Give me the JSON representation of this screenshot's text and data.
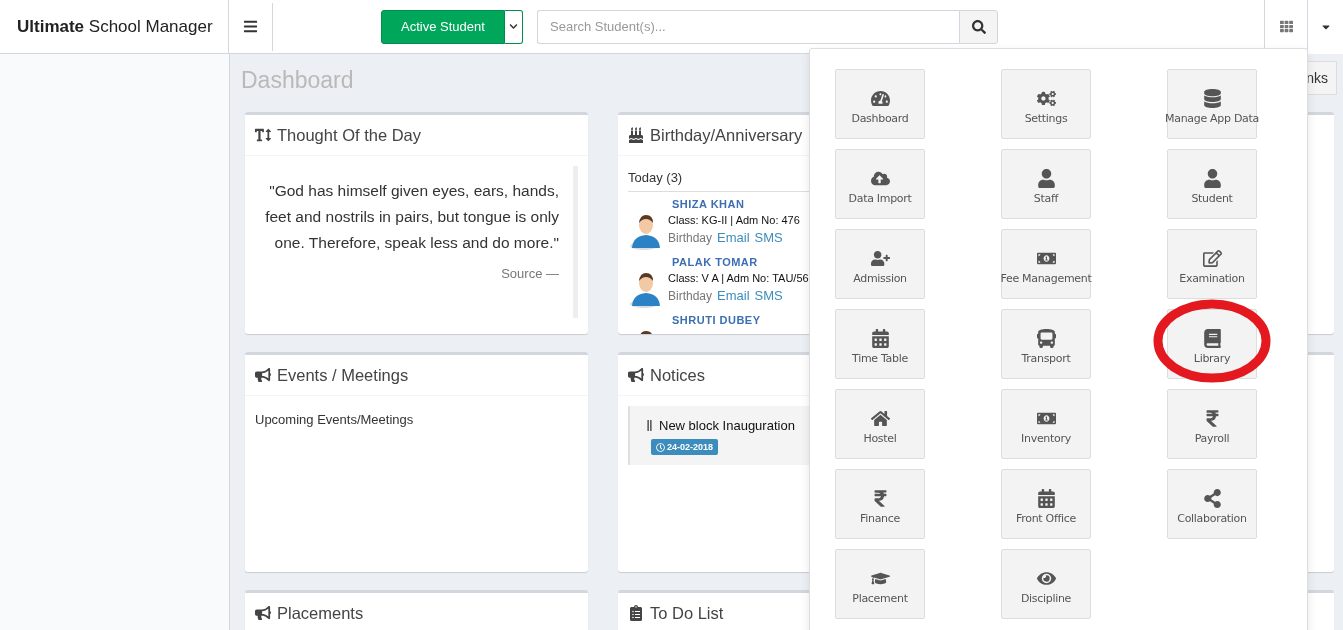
{
  "header": {
    "logo": "**Ultimate** School Manager",
    "student_filter": {
      "label": "Active Student"
    },
    "search": {
      "placeholder": "Search Student(s)..."
    }
  },
  "page_title": "Dashboard",
  "links_button": {
    "label": "nks"
  },
  "cards": [
    {
      "kind": "quote",
      "title": "Thought Of the Day",
      "quote": "\"God has himself given eyes, ears, hands, feet and nostrils in pairs, but tongue is only one. Therefore, speak less and do more.\"",
      "source": "Source —"
    },
    {
      "kind": "birthdays",
      "title": "Birthday/Anniversary",
      "subtitle": "Today (3)",
      "people": [
        {
          "name": "SHIZA KHAN",
          "details": "Class: KG-II | Adm No: 476",
          "occasion": "Birthday",
          "actions": [
            "Email",
            "SMS"
          ]
        },
        {
          "name": "PALAK TOMAR",
          "details": "Class: V A | Adm No: TAU/56",
          "occasion": "Birthday",
          "actions": [
            "Email",
            "SMS"
          ]
        },
        {
          "name": "SHRUTI DUBEY"
        }
      ]
    },
    {
      "kind": "covered"
    },
    {
      "kind": "events",
      "title": "Events / Meetings",
      "text": "Upcoming Events/Meetings"
    },
    {
      "kind": "notices",
      "title": "Notices",
      "notices": [
        {
          "title": "New block Inauguration",
          "date": "24-02-2018"
        }
      ]
    },
    {
      "kind": "covered"
    },
    {
      "kind": "placements",
      "title": "Placements"
    },
    {
      "kind": "todo",
      "title": "To Do List"
    },
    {
      "kind": "covered"
    }
  ],
  "app_menu": {
    "tiles": [
      {
        "label": "Dashboard",
        "highlighted": false
      },
      {
        "label": "Settings",
        "highlighted": false
      },
      {
        "label": "Manage App Data",
        "highlighted": false
      },
      {
        "label": "Data Import",
        "highlighted": false
      },
      {
        "label": "Staff",
        "highlighted": false
      },
      {
        "label": "Student",
        "highlighted": false
      },
      {
        "label": "Admission",
        "highlighted": false
      },
      {
        "label": "Fee Management",
        "highlighted": false
      },
      {
        "label": "Examination",
        "highlighted": false
      },
      {
        "label": "Time Table",
        "highlighted": false
      },
      {
        "label": "Transport",
        "highlighted": false
      },
      {
        "label": "Library",
        "highlighted": true
      },
      {
        "label": "Hostel",
        "highlighted": false
      },
      {
        "label": "Inventory",
        "highlighted": false
      },
      {
        "label": "Payroll",
        "highlighted": false
      },
      {
        "label": "Finance",
        "highlighted": false
      },
      {
        "label": "Front Office",
        "highlighted": false
      },
      {
        "label": "Collaboration",
        "highlighted": false
      },
      {
        "label": "Placement",
        "highlighted": false
      },
      {
        "label": "Discipline",
        "highlighted": false
      }
    ]
  }
}
